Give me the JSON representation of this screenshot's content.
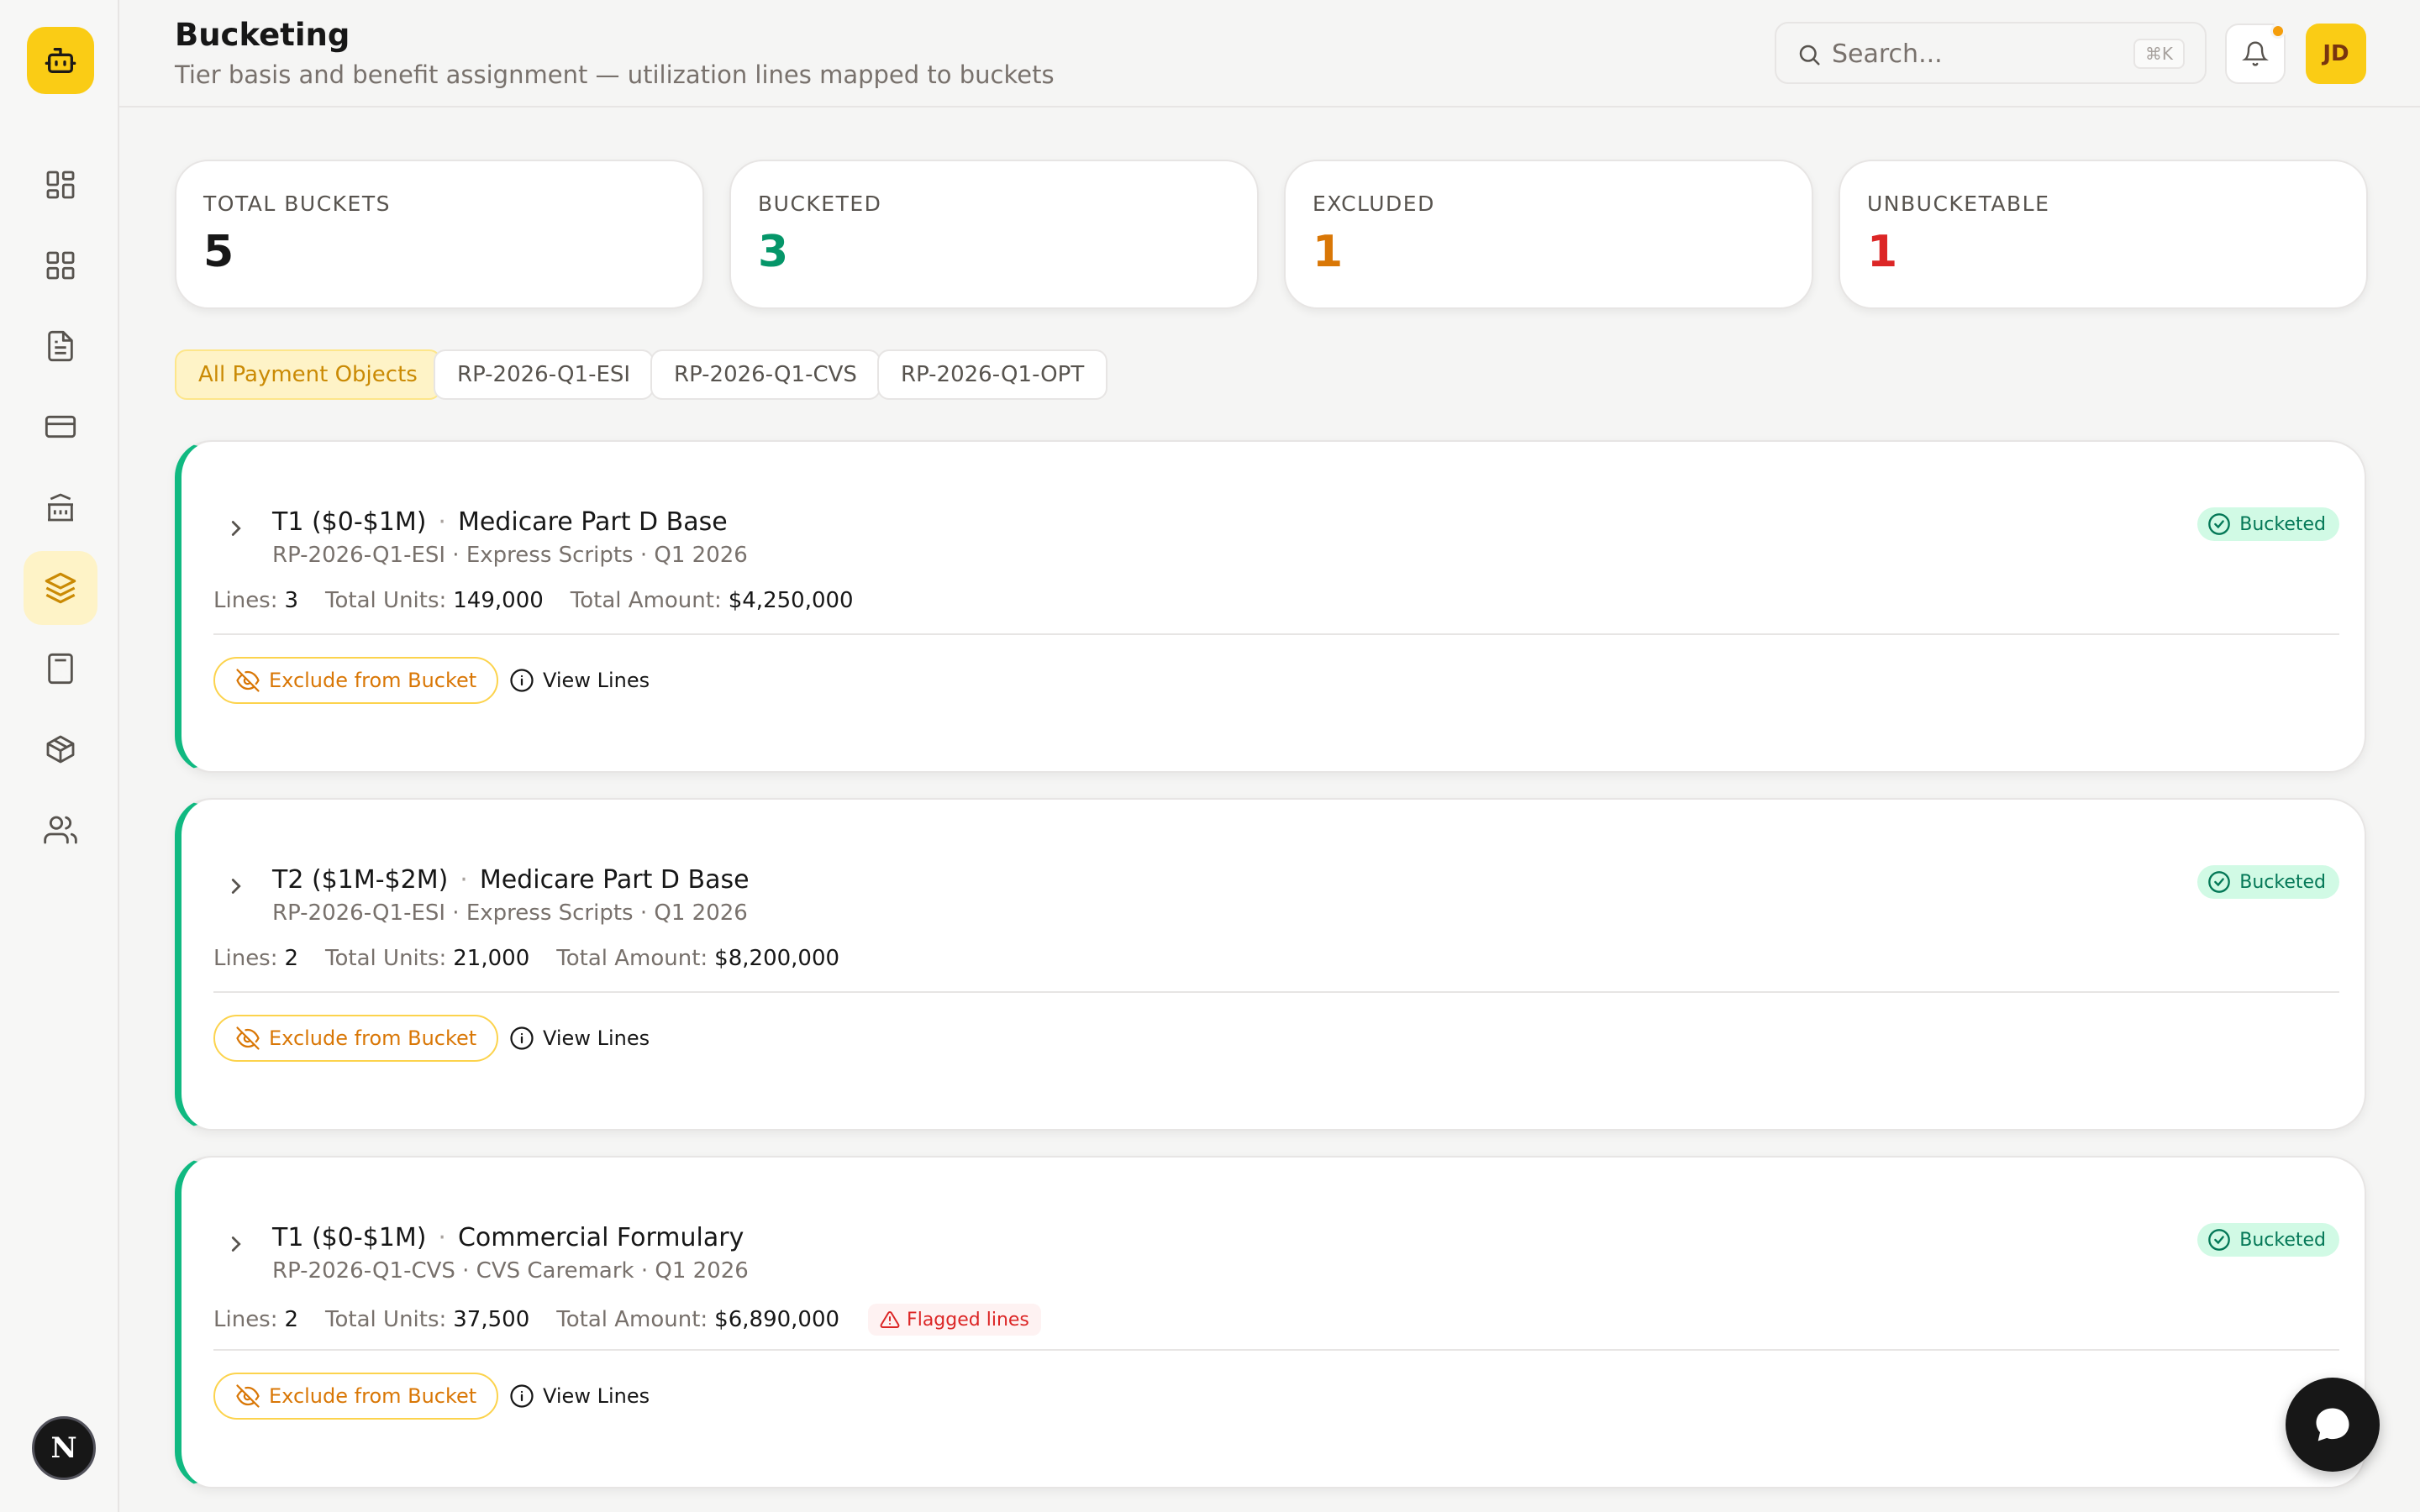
{
  "header": {
    "title": "Bucketing",
    "subtitle": "Tier basis and benefit assignment — utilization lines mapped to buckets",
    "search_placeholder": "Search...",
    "search_shortcut": "⌘K",
    "avatar_initials": "JD"
  },
  "sidebar": {
    "items": [
      {
        "icon": "dashboard-icon",
        "active": false
      },
      {
        "icon": "grid-icon",
        "active": false
      },
      {
        "icon": "document-icon",
        "active": false
      },
      {
        "icon": "credit-card-icon",
        "active": false
      },
      {
        "icon": "bank-icon",
        "active": false
      },
      {
        "icon": "layers-icon",
        "active": true
      },
      {
        "icon": "calculator-icon",
        "active": false
      },
      {
        "icon": "package-icon",
        "active": false
      },
      {
        "icon": "users-icon",
        "active": false
      }
    ],
    "footer_badge": "N"
  },
  "stats": [
    {
      "label": "TOTAL BUCKETS",
      "value": "5",
      "color": "#171717"
    },
    {
      "label": "BUCKETED",
      "value": "3",
      "color": "#059669"
    },
    {
      "label": "EXCLUDED",
      "value": "1",
      "color": "#d97706"
    },
    {
      "label": "UNBUCKETABLE",
      "value": "1",
      "color": "#dc2626"
    }
  ],
  "filters": [
    {
      "label": "All Payment Objects",
      "active": true
    },
    {
      "label": "RP-2026-Q1-ESI",
      "active": false
    },
    {
      "label": "RP-2026-Q1-CVS",
      "active": false
    },
    {
      "label": "RP-2026-Q1-OPT",
      "active": false
    }
  ],
  "labels": {
    "lines": "Lines:",
    "total_units": "Total Units:",
    "total_amount": "Total Amount:",
    "exclude": "Exclude from Bucket",
    "view_lines": "View Lines"
  },
  "buckets": [
    {
      "tier": "T1 ($0-$1M)",
      "benefit": "Medicare Part D Base",
      "subtitle": "RP-2026-Q1-ESI · Express Scripts · Q1 2026",
      "lines": "3",
      "units": "149,000",
      "amount": "$4,250,000",
      "status": "Bucketed",
      "flag": ""
    },
    {
      "tier": "T2 ($1M-$2M)",
      "benefit": "Medicare Part D Base",
      "subtitle": "RP-2026-Q1-ESI · Express Scripts · Q1 2026",
      "lines": "2",
      "units": "21,000",
      "amount": "$8,200,000",
      "status": "Bucketed",
      "flag": ""
    },
    {
      "tier": "T1 ($0-$1M)",
      "benefit": "Commercial Formulary",
      "subtitle": "RP-2026-Q1-CVS · CVS Caremark · Q1 2026",
      "lines": "2",
      "units": "37,500",
      "amount": "$6,890,000",
      "status": "Bucketed",
      "flag": "Flagged lines"
    }
  ]
}
